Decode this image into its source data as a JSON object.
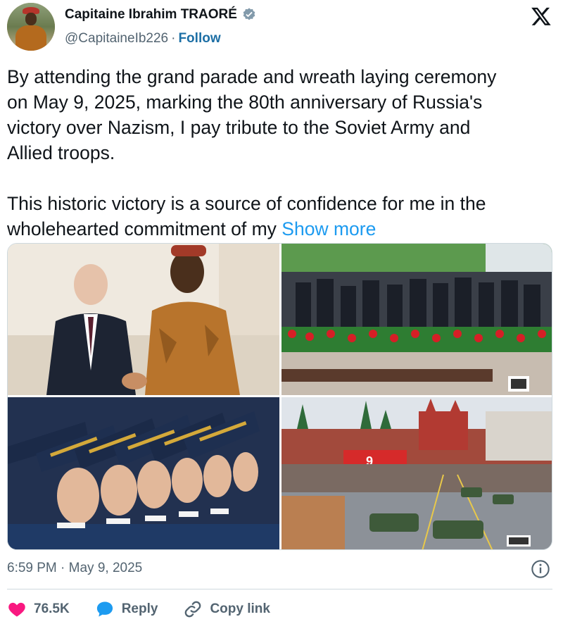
{
  "author": {
    "name": "Capitaine Ibrahim TRAORÉ",
    "handle": "@CapitaineIb226",
    "separator": "·",
    "follow_label": "Follow"
  },
  "tweet": {
    "paragraph1": "By attending the grand parade and wreath laying ceremony\non May 9, 2025, marking the 80th anniversary of Russia's\nvictory over Nazism, I pay tribute to the Soviet Army and\nAllied troops.",
    "paragraph2": "This historic victory is a source of confidence for me in the\nwholehearted commitment of my ",
    "show_more_label": "Show more"
  },
  "media": {
    "count": 4,
    "tile4_banner": "9"
  },
  "meta": {
    "timestamp": "6:59 PM · May 9, 2025"
  },
  "actions": {
    "like_count": "76.5K",
    "reply_label": "Reply",
    "copy_link_label": "Copy link"
  },
  "colors": {
    "like": "#f91880",
    "reply": "#1d9bf0",
    "link": "#1d9bf0",
    "verified": "#829aab"
  },
  "icons": [
    "verified-icon",
    "x-logo-icon",
    "info-icon",
    "heart-icon",
    "reply-icon",
    "link-icon"
  ]
}
